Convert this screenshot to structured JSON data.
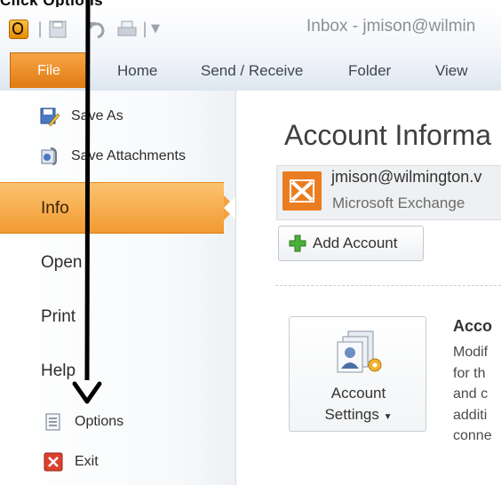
{
  "callout": "Click Options",
  "window": {
    "title": "Inbox - jmison@wilmin"
  },
  "tabs": [
    "File",
    "Home",
    "Send / Receive",
    "Folder",
    "View"
  ],
  "menu": {
    "save_as": "Save As",
    "save_attachments": "Save Attachments",
    "info": "Info",
    "open": "Open",
    "print": "Print",
    "help": "Help",
    "options": "Options",
    "exit": "Exit"
  },
  "main": {
    "heading": "Account Informa",
    "account_email": "jmison@wilmington.v",
    "account_type": "Microsoft Exchange",
    "add_account": "Add Account",
    "settings_line1": "Account",
    "settings_line2": "Settings",
    "settings_title": "Acco",
    "settings_desc": [
      "Modif",
      "for th",
      "and c",
      "additi",
      "conne"
    ]
  },
  "colors": {
    "file_tab": "#e8851f",
    "info_highlight": "#f6aa45",
    "accent_icon": "#e4741a"
  }
}
